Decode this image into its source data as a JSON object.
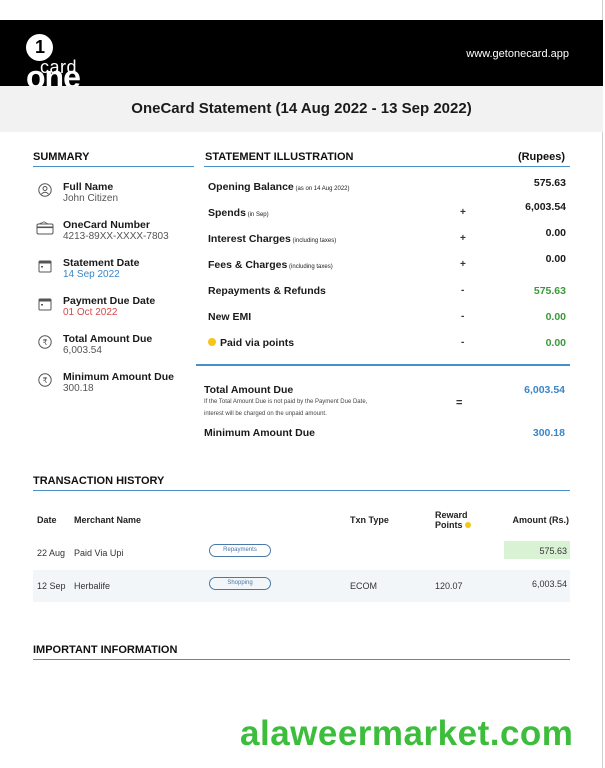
{
  "header": {
    "logo_one": "one",
    "logo_numeral": "1",
    "logo_card": "card",
    "site_url": "www.getonecard.app"
  },
  "statement_title": "OneCard Statement (14 Aug 2022 - 13 Sep 2022)",
  "summary": {
    "heading": "SUMMARY",
    "items": [
      {
        "icon": "user-icon",
        "label": "Full Name",
        "value": "John Citizen",
        "tone": "grey"
      },
      {
        "icon": "card-icon",
        "label": "OneCard Number",
        "value": "4213-89XX-XXXX-7803",
        "tone": "grey"
      },
      {
        "icon": "calendar-icon",
        "label": "Statement Date",
        "value": "14 Sep 2022",
        "tone": "blue"
      },
      {
        "icon": "calendar-icon",
        "label": "Payment Due Date",
        "value": "01 Oct 2022",
        "tone": "red"
      },
      {
        "icon": "rupee-icon",
        "label": "Total Amount Due",
        "value": "6,003.54",
        "tone": "grey"
      },
      {
        "icon": "rupee-icon",
        "label": "Minimum Amount Due",
        "value": "300.18",
        "tone": "grey"
      }
    ]
  },
  "illustration": {
    "heading": "STATEMENT ILLUSTRATION",
    "currency_note": "(Rupees)",
    "rows": [
      {
        "label": "Opening Balance",
        "note": "(as on 14 Aug 2022)",
        "op": "",
        "amount": "575.63",
        "tone": "black"
      },
      {
        "label": "Spends",
        "note": "(in Sep)",
        "op": "+",
        "amount": "6,003.54",
        "tone": "black"
      },
      {
        "label": "Interest Charges",
        "note": "(including taxes)",
        "op": "+",
        "amount": "0.00",
        "tone": "black"
      },
      {
        "label": "Fees & Charges",
        "note": "(including taxes)",
        "op": "+",
        "amount": "0.00",
        "tone": "black"
      },
      {
        "label": "Repayments & Refunds",
        "note": "",
        "op": "-",
        "amount": "575.63",
        "tone": "green"
      },
      {
        "label": "New EMI",
        "note": "",
        "op": "-",
        "amount": "0.00",
        "tone": "green"
      },
      {
        "label": "Paid via points",
        "note": "",
        "op": "-",
        "amount": "0.00",
        "tone": "green",
        "dot": true
      }
    ],
    "total_due": {
      "label": "Total Amount Due",
      "note_line1": "If the Total Amount Due is not paid by the Payment Due Date,",
      "note_line2": "interest will be charged on the unpaid amount.",
      "op": "=",
      "amount": "6,003.54"
    },
    "min_due": {
      "label": "Minimum Amount Due",
      "amount": "300.18"
    }
  },
  "transactions": {
    "heading": "TRANSACTION HISTORY",
    "columns": {
      "date": "Date",
      "merchant": "Merchant Name",
      "type": "Txn Type",
      "reward_line1": "Reward",
      "reward_line2": "Points",
      "amount": "Amount (Rs.)"
    },
    "rows": [
      {
        "date": "22 Aug",
        "merchant": "Paid Via Upi",
        "category": "Repayments",
        "type": "",
        "points": "",
        "amount": "575.63",
        "highlight": true
      },
      {
        "date": "12 Sep",
        "merchant": "Herbalife",
        "category": "Shopping",
        "type": "ECOM",
        "points": "120.07",
        "amount": "6,003.54",
        "highlight": false
      }
    ]
  },
  "important_info": {
    "heading": "IMPORTANT INFORMATION"
  },
  "watermark": "alaweermarket.com",
  "colors": {
    "accent_blue": "#3a86c8",
    "due_red": "#d94848",
    "positive_green": "#3a9a3a",
    "highlight_green": "#d9f2d3",
    "points_yellow": "#f5c518"
  }
}
